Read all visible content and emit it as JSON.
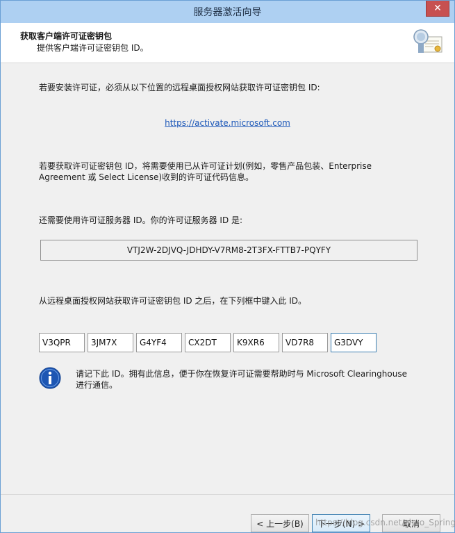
{
  "window": {
    "title": "服务器激活向导",
    "close_glyph": "✕"
  },
  "header": {
    "title": "获取客户端许可证密钥包",
    "subtitle": "提供客户端许可证密钥包 ID。",
    "icon": "certificate-icon"
  },
  "content": {
    "intro": "若要安装许可证，必须从以下位置的远程桌面授权网站获取许可证密钥包 ID:",
    "url": "https://activate.microsoft.com",
    "program_line1": "若要获取许可证密钥包 ID，将需要使用已从许可证计划(例如，零售产品包装、Enterprise",
    "program_line2": "Agreement 或 Select License)收到的许可证代码信息。",
    "server_label": "还需要使用许可证服务器 ID。你的许可证服务器 ID 是:",
    "server_id": "VTJ2W-2DJVQ-JDHDY-V7RM8-2T3FX-FTTB7-PQYFY",
    "enter_label": "从远程桌面授权网站获取许可证密钥包 ID 之后，在下列框中键入此 ID。",
    "key_parts": [
      "V3QPR",
      "3JM7X",
      "G4YF4",
      "CX2DT",
      "K9XR6",
      "VD7R8",
      "G3DVY"
    ],
    "info_line1": "请记下此 ID。拥有此信息，便于你在恢复许可证需要帮助时与 Microsoft Clearinghouse",
    "info_line2": "进行通信。",
    "info_icon": "info-icon"
  },
  "footer": {
    "back": "< 上一步(B)",
    "next": "下一步(N) >",
    "cancel": "取消",
    "watermark": "https://blog.csdn.net/zhuo_Spring"
  },
  "colors": {
    "titlebar": "#aed0f2",
    "close": "#c75050",
    "link": "#1a56b8",
    "info": "#1d56b3"
  }
}
